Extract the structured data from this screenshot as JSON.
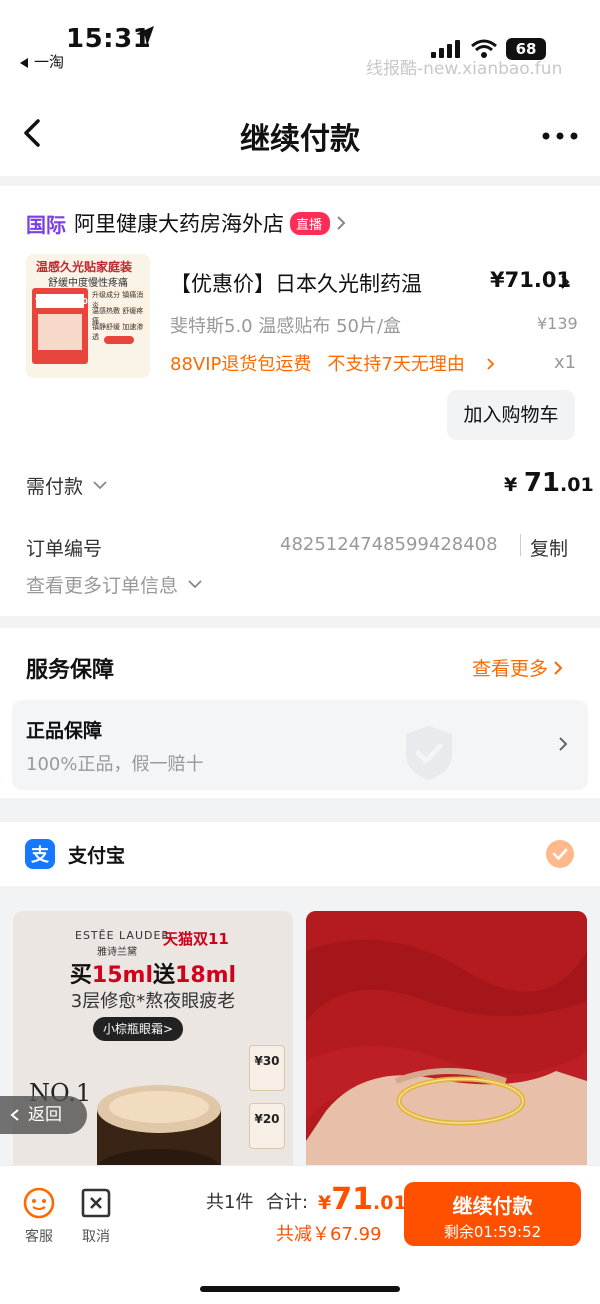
{
  "status_bar": {
    "time": "15:31",
    "back_app": "一淘",
    "battery": "68",
    "watermark": "线报酷-new.xianbao.fun"
  },
  "nav": {
    "title": "继续付款"
  },
  "store": {
    "intl_tag": "国际",
    "name": "阿里健康大药房海外店",
    "live_badge": "直播"
  },
  "product": {
    "title": "【优惠价】日本久光制药温",
    "price": "¥71.01",
    "spec": "斐特斯5.0 温感贴布 50片/盒",
    "original_price": "¥139",
    "tags": [
      "88VIP退货包运费",
      "不支持7天无理由"
    ],
    "quantity": "x1",
    "add_to_cart": "加入购物车",
    "image_text": {
      "line1": "温感久光贴家庭装",
      "line2": "舒缓中度慢性疼痛",
      "brand": "フェイタス5.0",
      "points": [
        "升级成分 镇痛消炎",
        "温感热敷 舒缓疼痛",
        "镇静舒缓 加速渗透"
      ]
    }
  },
  "payment": {
    "label": "需付款",
    "amount_currency": "¥ ",
    "amount_int": "71",
    "amount_dec": ".01"
  },
  "order": {
    "number_label": "订单编号",
    "number": "4825124748599428408",
    "copy": "复制",
    "more": "查看更多订单信息"
  },
  "service": {
    "title": "服务保障",
    "more": "查看更多",
    "item_title": "正品保障",
    "item_sub": "100%正品，假一赔十"
  },
  "pay_method": {
    "label": "支付宝"
  },
  "ads": {
    "ad1": {
      "brand": "ESTĒE LAUDER",
      "brand_cn": "雅诗兰黛",
      "event": "天猫双11",
      "headline_prefix": "买",
      "headline_red1": "15ml",
      "headline_mid": "送",
      "headline_red2": "18ml",
      "sub": "3层修愈*熬夜眼疲老",
      "pill": "小棕瓶眼霜>",
      "no1": "NO.1",
      "coupons": [
        "¥30",
        "¥20"
      ]
    }
  },
  "float_back": "返回",
  "bottom": {
    "service": "客服",
    "cancel": "取消",
    "count": "共1件",
    "total_label": "合计:",
    "total_currency": "¥",
    "total_int": "71",
    "total_dec": ".01",
    "saved": "共减￥67.99",
    "pay_button": "继续付款",
    "timer": "剩余01:59:52"
  },
  "colors": {
    "accent": "#ff5000",
    "orange_text": "#ff6a00",
    "intl_purple": "#7b3fe4",
    "live_red": "#ff2c55",
    "alipay_blue": "#1677ff"
  }
}
